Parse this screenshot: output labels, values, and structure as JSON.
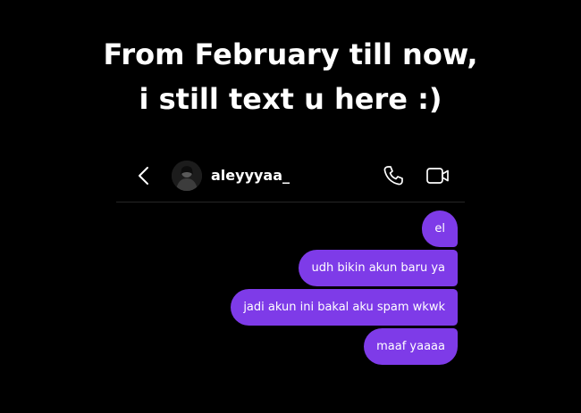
{
  "caption": {
    "line1": "From February till now,",
    "line2": "i still text u here :)"
  },
  "header": {
    "back_icon": "chevron-left-icon",
    "avatar_icon": "profile-avatar",
    "username": "aleyyyaa_",
    "call_icon": "phone-icon",
    "video_icon": "video-camera-icon"
  },
  "messages": [
    {
      "text": "el"
    },
    {
      "text": "udh bikin akun baru ya"
    },
    {
      "text": "jadi akun ini bakal aku spam wkwk"
    },
    {
      "text": "maaf yaaaa"
    }
  ],
  "colors": {
    "background": "#000000",
    "bubble": "#7e3be8",
    "text": "#ffffff",
    "divider": "#262626"
  }
}
